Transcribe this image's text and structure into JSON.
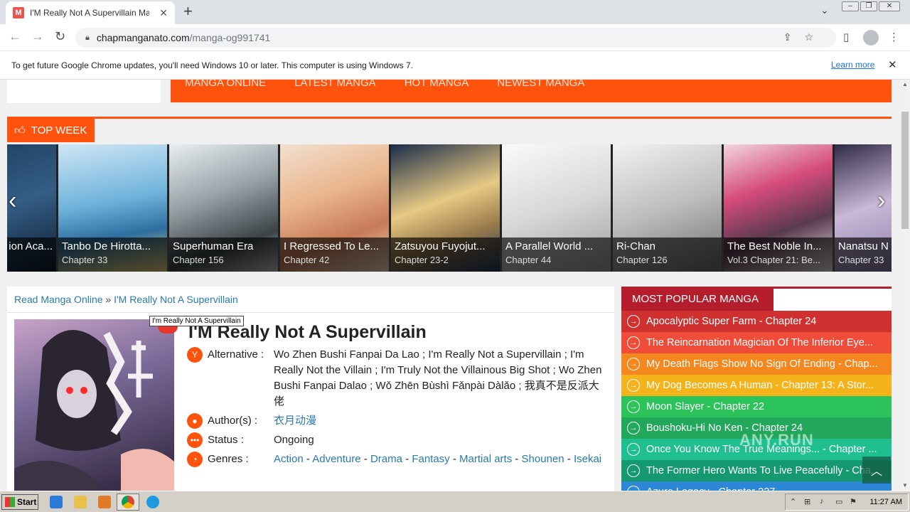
{
  "browser": {
    "tab_title": "I'M Really Not A Supervillain Manga O",
    "tab_favicon": "M",
    "url_host": "chapmanganato.com",
    "url_path": "/manga-og991741",
    "info_message": "To get future Google Chrome updates, you'll need Windows 10 or later. This computer is using Windows 7.",
    "info_link": "Learn more"
  },
  "site": {
    "menu": [
      "MANGA ONLINE",
      "LATEST MANGA",
      "HOT MANGA",
      "NEWEST MANGA"
    ],
    "top_week_label": "TOP WEEK",
    "accent": "#ff530d",
    "slider": [
      {
        "title": "ion Aca...",
        "chapter": ""
      },
      {
        "title": "Tanbo De Hirotta...",
        "chapter": "Chapter 33"
      },
      {
        "title": "Superhuman Era",
        "chapter": "Chapter 156"
      },
      {
        "title": "I Regressed To Le...",
        "chapter": "Chapter 42"
      },
      {
        "title": "Zatsuyou Fuyojut...",
        "chapter": "Chapter 23-2"
      },
      {
        "title": "A Parallel World ...",
        "chapter": "Chapter 44"
      },
      {
        "title": "Ri-Chan",
        "chapter": "Chapter 126"
      },
      {
        "title": "The Best Noble In...",
        "chapter": "Vol.3 Chapter 21: Be..."
      },
      {
        "title": "Nanatsu N",
        "chapter": "Chapter 33"
      }
    ]
  },
  "breadcrumb": {
    "home": "Read Manga Online",
    "sep": "»",
    "current": "I'M Really Not A Supervillain"
  },
  "tooltip": "I'm Really Not A Supervillain",
  "manga": {
    "title": "I'M Really Not A Supervillain",
    "alternative_label": "Alternative :",
    "alternative": "Wo Zhen Bushi Fanpai Da Lao ; I'm Really Not a Supervillain ; I'm Really Not the Villain ; I'm Truly Not the Villainous Big Shot ; Wo Zhen Bushi Fanpai Dalao ; Wǒ Zhēn Bùshì Fǎnpài Dàlǎo ; 我真不是反派大佬",
    "author_label": "Author(s) :",
    "author": "衣月动漫",
    "status_label": "Status :",
    "status": "Ongoing",
    "genres_label": "Genres :",
    "genres": [
      "Action",
      "Adventure",
      "Drama",
      "Fantasy",
      "Martial arts",
      "Shounen",
      "Isekai"
    ],
    "genre_sep": "-"
  },
  "popular": {
    "heading": "MOST POPULAR MANGA",
    "items": [
      {
        "text": "Apocalyptic Super Farm - Chapter 24",
        "color": "#cf3130"
      },
      {
        "text": "The Reincarnation Magician Of The Inferior Eye...",
        "color": "#ef4d39"
      },
      {
        "text": "My Death Flags Show No Sign Of Ending - Chap...",
        "color": "#f5871f"
      },
      {
        "text": "My Dog Becomes A Human - Chapter 13: A Stor...",
        "color": "#f5b31b"
      },
      {
        "text": "Moon Slayer - Chapter 22",
        "color": "#2cc35b"
      },
      {
        "text": "Boushoku-Hi No Ken - Chapter 24",
        "color": "#22a85a"
      },
      {
        "text": "Once You Know The True Meanings... - Chapter ...",
        "color": "#1fbf8f"
      },
      {
        "text": "The Former Hero Wants To Live Peacefully - Cha...",
        "color": "#149a6e"
      },
      {
        "text": "Azure Legacy - Chapter 227",
        "color": "#2d86d6"
      }
    ]
  },
  "watermark": "ANY.RUN",
  "taskbar": {
    "start_label": "Start",
    "clock": "11:27 AM"
  }
}
